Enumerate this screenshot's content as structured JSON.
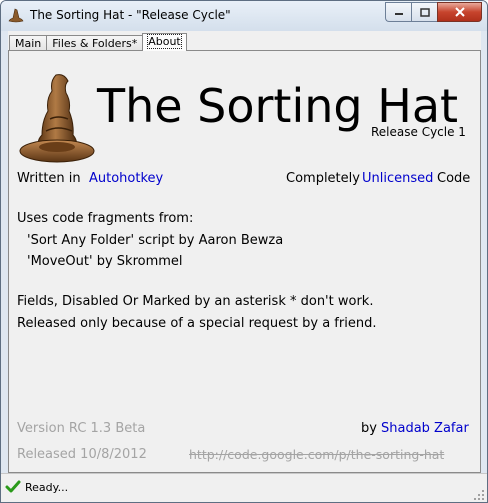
{
  "window": {
    "title": "The Sorting Hat - \"Release Cycle\"",
    "icons": {
      "app": "sorting-hat-icon",
      "minimize": "minimize-icon",
      "maximize": "maximize-icon",
      "close": "close-icon"
    }
  },
  "tabs": [
    {
      "label": "Main",
      "active": false
    },
    {
      "label": "Files & Folders*",
      "active": false
    },
    {
      "label": "About",
      "active": true
    }
  ],
  "about": {
    "logo_icon": "sorting-hat-icon",
    "heading": "The Sorting Hat",
    "release": "Release Cycle 1",
    "written_in_label": "Written in",
    "written_in_link": "Autohotkey",
    "license_prefix": "Completely",
    "license_link": "Unlicensed",
    "license_suffix": "Code",
    "fragments_intro": "Uses code fragments from:",
    "fragment_1": "'Sort Any Folder' script by Aaron Bewza",
    "fragment_2": "'MoveOut' by Skrommel",
    "note_1": "Fields, Disabled Or Marked by an asterisk * don't work.",
    "note_2": "Released only because of a special request by a friend.",
    "version": "Version RC 1.3 Beta",
    "released": "Released 10/8/2012",
    "author_prefix": "by",
    "author_link": "Shadab Zafar",
    "url": "http://code.google.com/p/the-sorting-hat"
  },
  "statusbar": {
    "text": "Ready...",
    "icon": "checkmark-icon"
  },
  "colors": {
    "link": "#0000cc",
    "disabled_text": "#a4a4a4",
    "panel_bg": "#f0f0f0"
  }
}
